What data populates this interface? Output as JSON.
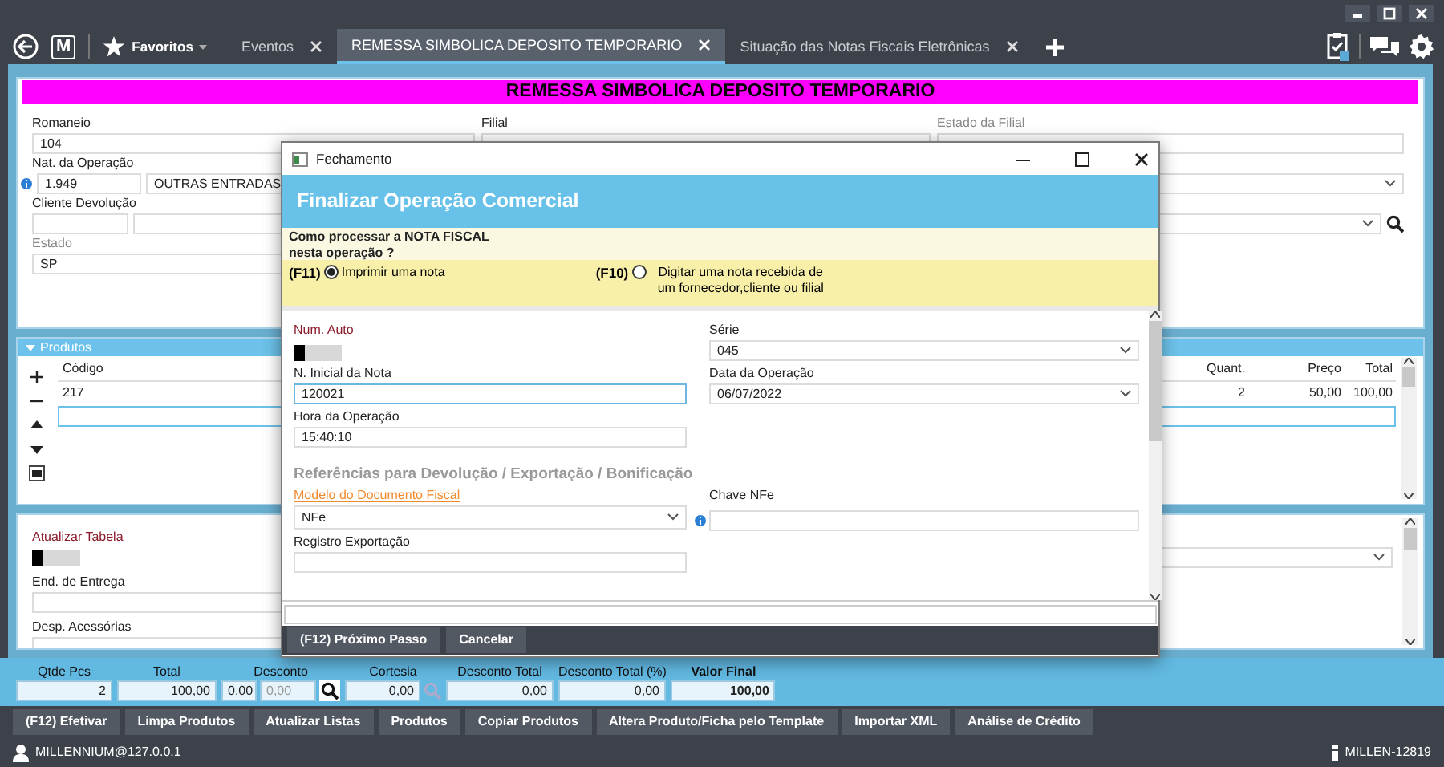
{
  "top_bar": {
    "logo": "M",
    "favorites": "Favoritos"
  },
  "tabs": [
    {
      "label": "Eventos",
      "selected": false
    },
    {
      "label": "REMESSA SIMBOLICA DEPOSITO TEMPORARIO",
      "selected": true
    },
    {
      "label": "Situação das Notas Fiscais Eletrônicas",
      "selected": false
    }
  ],
  "page_title": "REMESSA SIMBOLICA DEPOSITO TEMPORARIO",
  "header_form": {
    "romaneio": {
      "label": "Romaneio",
      "value": "104"
    },
    "filial": {
      "label": "Filial"
    },
    "estado_filial": {
      "label": "Estado da Filial"
    },
    "nat_operacao": {
      "label": "Nat. da Operação",
      "code": "1.949",
      "description": "OUTRAS ENTRADAS"
    },
    "cliente_devolucao": {
      "label": "Cliente Devolução"
    },
    "estado": {
      "label": "Estado",
      "value": "SP"
    }
  },
  "products": {
    "title": "Produtos",
    "columns": [
      "Código",
      "Quant.",
      "Preço",
      "Total"
    ],
    "rows": [
      [
        "217",
        "2",
        "50,00",
        "100,00"
      ]
    ]
  },
  "details_form": {
    "atualizar_tabela": {
      "label": "Atualizar Tabela",
      "on": false
    },
    "end_entrega": {
      "label": "End. de Entrega"
    },
    "desp_acessorias": {
      "label": "Desp. Acessórias"
    }
  },
  "totals": [
    {
      "kind": "plain",
      "label": "Qtde Pcs",
      "value": "2"
    },
    {
      "kind": "plain",
      "label": "Total",
      "value": "100,00"
    },
    {
      "kind": "discount",
      "label": "Desconto",
      "value": "0,00",
      "value_2": "0,00"
    },
    {
      "kind": "search",
      "label": "Cortesia",
      "value": "0,00"
    },
    {
      "kind": "plain",
      "label": "Desconto Total",
      "value": "0,00"
    },
    {
      "kind": "plain",
      "label": "Desconto Total (%)",
      "value": "0,00"
    },
    {
      "kind": "final",
      "label": "Valor Final",
      "value": "100,00"
    }
  ],
  "actions": [
    "(F12) Efetivar",
    "Limpa Produtos",
    "Atualizar Listas",
    "Produtos",
    "Copiar Produtos",
    "Altera Produto/Ficha pelo Template",
    "Importar XML",
    "Análise de Crédito"
  ],
  "status_bar": {
    "user": "MILLENNIUM@127.0.0.1",
    "version": "MILLEN-12819"
  },
  "dialog": {
    "title": "Fechamento",
    "heading": "Finalizar Operação Comercial",
    "question": "Como processar a NOTA FISCAL nesta operação ?",
    "options": [
      {
        "key": "(F11)",
        "label": "Imprimir uma nota",
        "selected": true
      },
      {
        "key": "(F10)",
        "label": "Digitar uma nota recebida de um fornecedor,cliente ou filial",
        "selected": false
      }
    ],
    "num_auto": {
      "label": "Num. Auto",
      "on": false
    },
    "serie": {
      "label": "Série",
      "value": "045"
    },
    "n_inicial": {
      "label": "N. Inicial da Nota",
      "value": "120021",
      "focused": true
    },
    "data_operacao": {
      "label": "Data da Operação",
      "value": "06/07/2022"
    },
    "hora_operacao": {
      "label": "Hora da Operação",
      "value": "15:40:10"
    },
    "section_title": "Referências para Devolução / Exportação / Bonificação",
    "modelo": {
      "label": "Modelo do Documento Fiscal",
      "value": "NFe"
    },
    "chave_nfe": {
      "label": "Chave NFe"
    },
    "registro_exportacao": {
      "label": "Registro Exportação"
    },
    "buttons": [
      "(F12) Próximo Passo",
      "Cancelar"
    ]
  }
}
